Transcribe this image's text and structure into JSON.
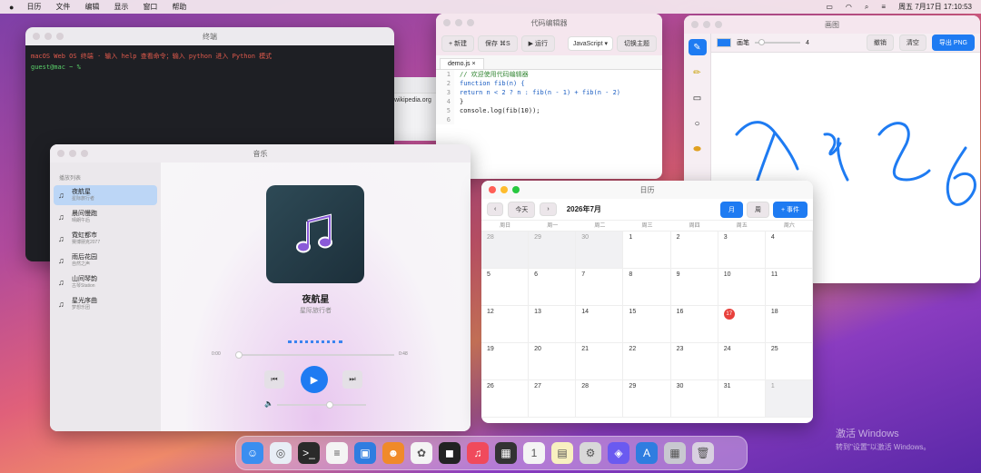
{
  "menubar": {
    "apple_icon": "apple-icon",
    "items": [
      "日历",
      "文件",
      "编辑",
      "显示",
      "窗口",
      "帮助"
    ],
    "clock": "周五 7月17日 17:10:53"
  },
  "terminal": {
    "title": "终端",
    "line1": "macOS Web OS 终端 · 输入 help 查看命令；输入 python 进入 Python 模式",
    "line2": "guest@mac ~ %"
  },
  "browser": {
    "url_text": "wikipedia.org"
  },
  "code_editor": {
    "title": "代码编辑器",
    "new_label": "+ 新建",
    "save_label": "保存 ⌘S",
    "run_label": "▶ 运行",
    "language": "JavaScript",
    "theme_label": "切换主题",
    "tab": "demo.js",
    "line_numbers": [
      "1",
      "2",
      "3",
      "4",
      "5",
      "6"
    ],
    "lines": [
      "// 欢迎使用代码编辑器",
      "function fib(n) {",
      "  return n < 2 ? n : fib(n - 1) + fib(n - 2)",
      "}",
      "console.log(fib(10));",
      ""
    ]
  },
  "draw_app": {
    "title": "画图",
    "stroke_label": "画笔",
    "stroke_value": "4",
    "undo_label": "撤销",
    "clear_label": "清空",
    "export_label": "导出 PNG",
    "pen_color": "#1e7bf2",
    "tools": [
      "pen-icon",
      "pencil-icon",
      "rectangle-icon",
      "circle-icon",
      "eraser-icon"
    ]
  },
  "music": {
    "title": "音乐",
    "playlist_label": "播放列表",
    "tracks": [
      {
        "title": "夜航星",
        "artist": "星际旅行者"
      },
      {
        "title": "晨间慢跑",
        "artist": "晴朗午后"
      },
      {
        "title": "霓虹都市",
        "artist": "赛博朋克2077"
      },
      {
        "title": "雨后花园",
        "artist": "自然之声"
      },
      {
        "title": "山间琴韵",
        "artist": "古琴Station"
      },
      {
        "title": "星光序曲",
        "artist": "梦想乐团"
      }
    ],
    "now_title": "夜航星",
    "now_artist": "星际旅行者",
    "time_left": "0:00",
    "time_right": "0:48",
    "progress": 0.0,
    "volume": 0.6
  },
  "calendar": {
    "title": "日历",
    "today_label": "今天",
    "month_label": "2026年7月",
    "view_month": "月",
    "view_week": "周",
    "new_event": "+ 事件",
    "weekdays": [
      "周日",
      "周一",
      "周二",
      "周三",
      "周四",
      "周五",
      "周六"
    ],
    "days": [
      {
        "d": "28",
        "o": true
      },
      {
        "d": "29",
        "o": true
      },
      {
        "d": "30",
        "o": true
      },
      {
        "d": "1"
      },
      {
        "d": "2"
      },
      {
        "d": "3"
      },
      {
        "d": "4"
      },
      {
        "d": "5"
      },
      {
        "d": "6"
      },
      {
        "d": "7"
      },
      {
        "d": "8"
      },
      {
        "d": "9"
      },
      {
        "d": "10"
      },
      {
        "d": "11"
      },
      {
        "d": "12"
      },
      {
        "d": "13"
      },
      {
        "d": "14"
      },
      {
        "d": "15"
      },
      {
        "d": "16"
      },
      {
        "d": "17",
        "t": true
      },
      {
        "d": "18"
      },
      {
        "d": "19"
      },
      {
        "d": "20"
      },
      {
        "d": "21"
      },
      {
        "d": "22"
      },
      {
        "d": "23"
      },
      {
        "d": "24"
      },
      {
        "d": "25"
      },
      {
        "d": "26"
      },
      {
        "d": "27"
      },
      {
        "d": "28"
      },
      {
        "d": "29"
      },
      {
        "d": "30"
      },
      {
        "d": "31"
      },
      {
        "d": "1",
        "o": true
      }
    ]
  },
  "dock": [
    {
      "name": "finder-icon",
      "g": "☺",
      "c": "#3a8ef0"
    },
    {
      "name": "safari-icon",
      "g": "◎",
      "c": "#e8eef6"
    },
    {
      "name": "terminal-icon",
      "g": ">_",
      "c": "#2a2a2a"
    },
    {
      "name": "text-editor-icon",
      "g": "≡",
      "c": "#f4f4f4"
    },
    {
      "name": "preview-icon",
      "g": "▣",
      "c": "#2f7de0"
    },
    {
      "name": "face-icon",
      "g": "☻",
      "c": "#f08a2a"
    },
    {
      "name": "photos-icon",
      "g": "✿",
      "c": "#f4f4f4"
    },
    {
      "name": "media-icon",
      "g": "◼",
      "c": "#222"
    },
    {
      "name": "music-icon",
      "g": "♫",
      "c": "#f04a5c"
    },
    {
      "name": "calculator-icon",
      "g": "▦",
      "c": "#333"
    },
    {
      "name": "calendar-icon",
      "g": "1",
      "c": "#f4f4f4"
    },
    {
      "name": "notes-icon",
      "g": "▤",
      "c": "#f8f0c0"
    },
    {
      "name": "settings-icon",
      "g": "⚙",
      "c": "#d8d8d8"
    },
    {
      "name": "game-icon",
      "g": "◈",
      "c": "#6a5af0"
    },
    {
      "name": "app-store-icon",
      "g": "A",
      "c": "#2f7de0"
    },
    {
      "name": "launchpad-icon",
      "g": "▦",
      "c": "#c8c8d0"
    },
    {
      "name": "trash-icon",
      "g": "🗑",
      "c": "#d8d0e0"
    }
  ],
  "watermark": {
    "line1": "激活 Windows",
    "line2": "转到\"设置\"以激活 Windows。"
  }
}
